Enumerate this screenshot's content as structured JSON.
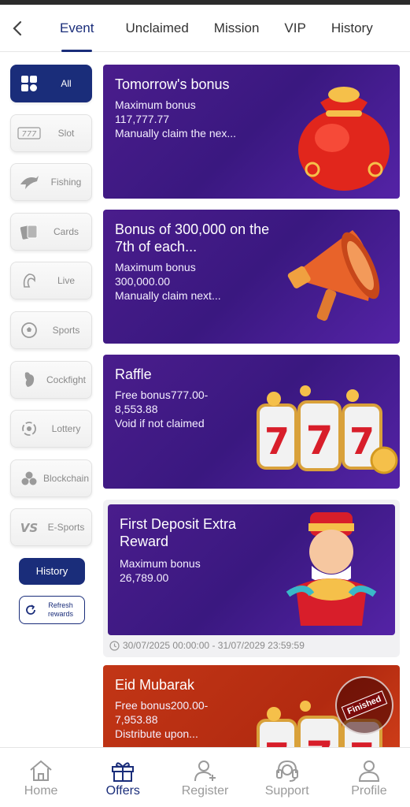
{
  "tabs": [
    {
      "label": "Event"
    },
    {
      "label": "Unclaimed"
    },
    {
      "label": "Mission"
    },
    {
      "label": "VIP"
    },
    {
      "label": "History"
    }
  ],
  "sidebar": {
    "items": [
      {
        "label": "All",
        "icon": "grid-icon"
      },
      {
        "label": "Slot",
        "icon": "slot-777-icon"
      },
      {
        "label": "Fishing",
        "icon": "fish-icon"
      },
      {
        "label": "Cards",
        "icon": "cards-icon"
      },
      {
        "label": "Live",
        "icon": "dealer-icon"
      },
      {
        "label": "Sports",
        "icon": "soccer-ball-icon"
      },
      {
        "label": "Cockfight",
        "icon": "rooster-icon"
      },
      {
        "label": "Lottery",
        "icon": "lottery-icon"
      },
      {
        "label": "Blockchain",
        "icon": "blockchain-icon"
      },
      {
        "label": "E-Sports",
        "icon": "vs-icon"
      }
    ],
    "history_label": "History",
    "refresh_label_1": "Refresh",
    "refresh_label_2": "rewards"
  },
  "cards": [
    {
      "title": "Tomorrow's bonus",
      "line1": "Maximum bonus",
      "line2": "117,777.77",
      "line3": "Manually claim the nex..."
    },
    {
      "title": "Bonus of 300,000 on the 7th of each...",
      "line1": "Maximum bonus",
      "line2": "300,000.00",
      "line3": "Manually claim next..."
    },
    {
      "title": "Raffle",
      "line1": "Free bonus777.00-",
      "line2": "8,553.88",
      "line3": "Void if not claimed"
    },
    {
      "title": "First Deposit Extra Reward",
      "line1": "Maximum bonus",
      "line2": "26,789.00",
      "date": "30/07/2025 00:00:00 - 31/07/2029 23:59:59"
    },
    {
      "title": "Eid Mubarak",
      "line1": "Free bonus200.00-",
      "line2": "7,953.88",
      "line3": "Distribute upon...",
      "badge": "Finished"
    }
  ],
  "bottom_nav": [
    {
      "label": "Home"
    },
    {
      "label": "Offers"
    },
    {
      "label": "Register"
    },
    {
      "label": "Support"
    },
    {
      "label": "Profile"
    }
  ],
  "colors": {
    "accent": "#1a2d7a",
    "card_purple": "#4a1d8c",
    "card_red": "#c23616"
  }
}
